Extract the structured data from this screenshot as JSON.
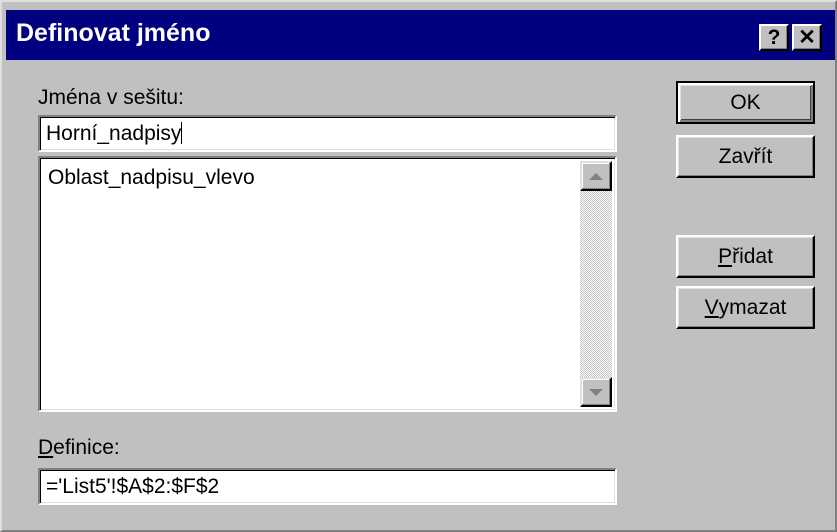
{
  "window": {
    "title": "Definovat jméno",
    "help_label": "?",
    "close_label": "✕"
  },
  "names": {
    "label_rest": "Jména v sešitu:",
    "input_value": "Horní_nadpisy",
    "list_items": [
      "Oblast_nadpisu_vlevo"
    ]
  },
  "definition": {
    "label_accel": "D",
    "label_rest": "efinice:",
    "value": "='List5'!$A$2:$F$2"
  },
  "buttons": {
    "ok": "OK",
    "close": "Zavřít",
    "add_accel": "P",
    "add_rest": "řidat",
    "delete_accel": "V",
    "delete_rest": "ymazat"
  },
  "colors": {
    "titlebar": "#000080",
    "dialog_bg": "#c0c0c0"
  }
}
